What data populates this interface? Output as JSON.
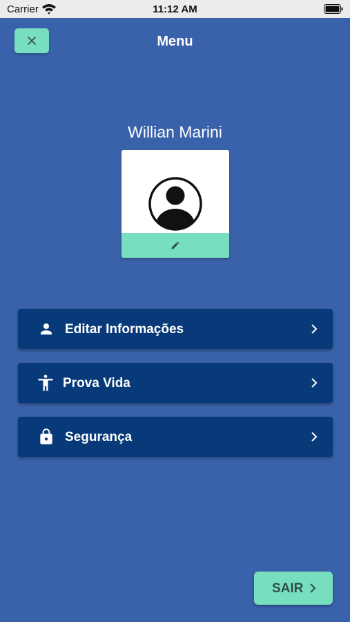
{
  "status_bar": {
    "carrier": "Carrier",
    "time": "11:12 AM"
  },
  "header": {
    "title": "Menu",
    "close_icon": "close-icon"
  },
  "profile": {
    "name": "Willian Marini",
    "avatar_icon": "account-circle-icon",
    "edit_icon": "pencil-icon"
  },
  "menu": {
    "items": [
      {
        "label": "Editar Informações",
        "icon": "person-icon"
      },
      {
        "label": "Prova Vida",
        "icon": "accessibility-icon"
      },
      {
        "label": "Segurança",
        "icon": "lock-icon"
      }
    ]
  },
  "footer": {
    "exit_label": "SAIR",
    "exit_icon": "chevron-right-icon"
  },
  "colors": {
    "background": "#3a62aa",
    "accent": "#77dfbf",
    "menu_item": "#083a7a"
  }
}
